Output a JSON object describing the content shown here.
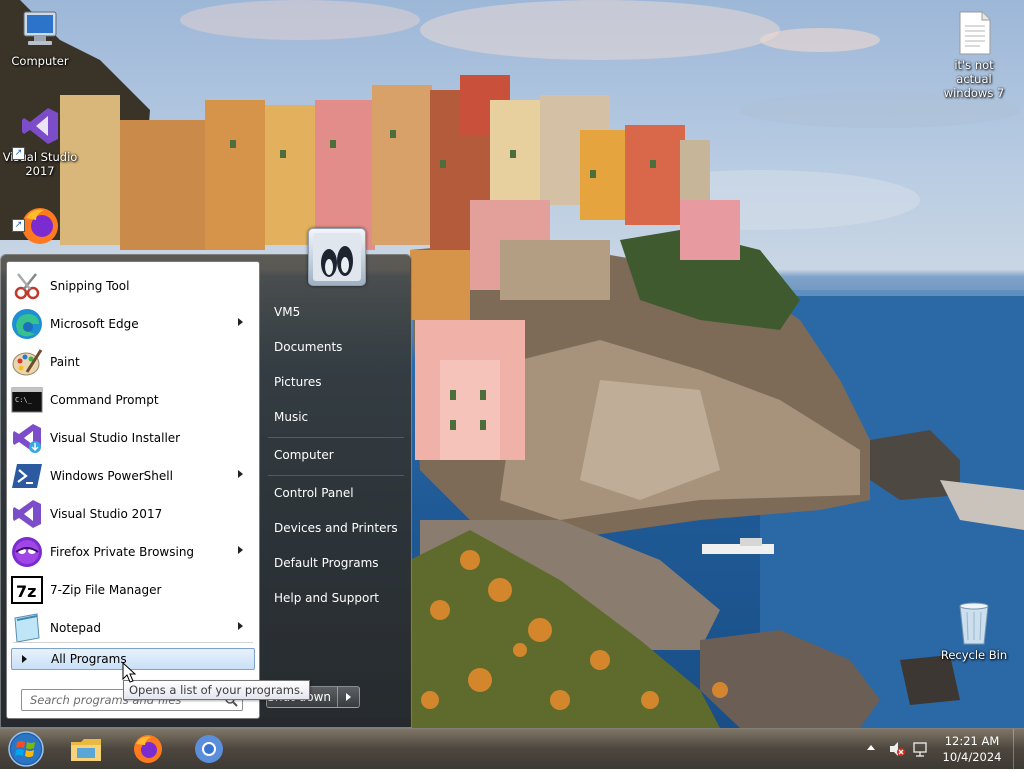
{
  "desktop": {
    "icons": [
      {
        "label": "Computer"
      },
      {
        "label": "Visual Studio 2017"
      },
      {
        "label": "it's not actual windows 7"
      },
      {
        "label": "Recycle Bin"
      }
    ]
  },
  "start_menu": {
    "programs": [
      {
        "label": "Snipping Tool",
        "icon": "scissors-icon",
        "submenu": false
      },
      {
        "label": "Microsoft Edge",
        "icon": "edge-icon",
        "submenu": true
      },
      {
        "label": "Paint",
        "icon": "paint-palette-icon",
        "submenu": false
      },
      {
        "label": "Command Prompt",
        "icon": "terminal-icon",
        "submenu": false
      },
      {
        "label": "Visual Studio Installer",
        "icon": "vs-installer-icon",
        "submenu": false
      },
      {
        "label": "Windows PowerShell",
        "icon": "powershell-icon",
        "submenu": true
      },
      {
        "label": "Visual Studio 2017",
        "icon": "visual-studio-icon",
        "submenu": false
      },
      {
        "label": "Firefox Private Browsing",
        "icon": "firefox-private-icon",
        "submenu": true
      },
      {
        "label": "7-Zip File Manager",
        "icon": "7zip-icon",
        "submenu": false
      },
      {
        "label": "Notepad",
        "icon": "notepad-icon",
        "submenu": true
      }
    ],
    "all_programs": "All Programs",
    "search_placeholder": "Search programs and files",
    "right_items": [
      {
        "label": "VM5"
      },
      {
        "label": "Documents"
      },
      {
        "label": "Pictures"
      },
      {
        "label": "Music"
      },
      {
        "label": "Computer"
      },
      {
        "label": "Control Panel"
      },
      {
        "label": "Devices and Printers"
      },
      {
        "label": "Default Programs"
      },
      {
        "label": "Help and Support"
      }
    ],
    "shutdown_label": "Shut down",
    "tooltip": "Opens a list of your programs."
  },
  "taskbar": {
    "pinned": [
      "file-explorer-icon",
      "firefox-icon",
      "chromium-icon"
    ],
    "time": "12:21 AM",
    "date": "10/4/2024"
  },
  "colors": {
    "taskbar": "#4a443c",
    "selection": "#c9e0f7"
  }
}
